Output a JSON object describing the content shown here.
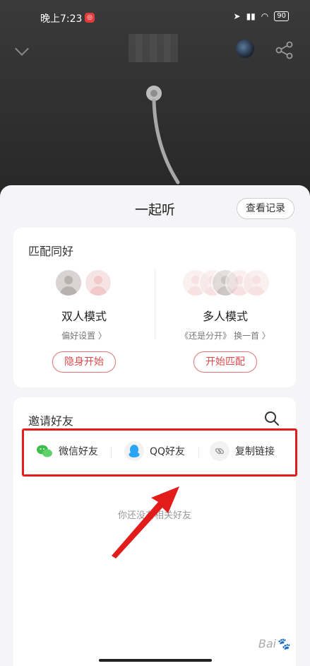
{
  "status_bar": {
    "time": "晚上7:23",
    "battery": "90"
  },
  "sheet": {
    "title": "一起听",
    "records_button": "查看记录"
  },
  "match": {
    "title": "匹配同好",
    "duo": {
      "name": "双人模式",
      "sub": "偏好设置 〉",
      "button": "隐身开始"
    },
    "multi": {
      "name": "多人模式",
      "sub": "《还是分开》 换一首 〉",
      "button": "开始匹配"
    }
  },
  "invite": {
    "title": "邀请好友",
    "options": [
      {
        "label": "微信好友",
        "icon": "wechat-icon"
      },
      {
        "label": "QQ好友",
        "icon": "qq-icon"
      },
      {
        "label": "复制链接",
        "icon": "link-icon"
      }
    ],
    "empty_text": "你还没有相关好友"
  },
  "colors": {
    "accent": "#e04a4a",
    "highlight": "#e21b1b"
  }
}
